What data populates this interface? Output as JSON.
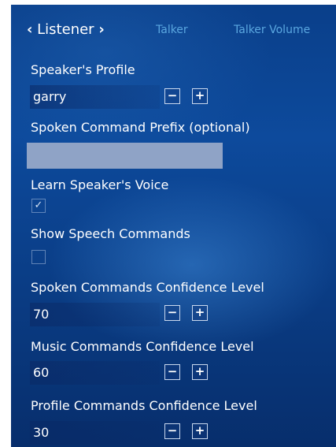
{
  "tabs": {
    "listener": "Listener",
    "talker": "Talker",
    "talker_volume": "Talker Volume"
  },
  "icons": {
    "prev": "chevron-left-icon",
    "next": "chevron-right-icon",
    "minus": "minus-icon",
    "plus": "plus-icon",
    "check": "checkmark-icon"
  },
  "settings": {
    "speakers_profile": {
      "label": "Speaker's Profile",
      "value": "garry"
    },
    "command_prefix": {
      "label": "Spoken Command Prefix (optional)",
      "value": ""
    },
    "learn_voice": {
      "label": "Learn Speaker's Voice",
      "checked": true
    },
    "show_commands": {
      "label": "Show Speech Commands",
      "checked": false
    },
    "spoken_confidence": {
      "label": "Spoken Commands Confidence Level",
      "value": "70"
    },
    "music_confidence": {
      "label": "Music Commands Confidence Level",
      "value": "60"
    },
    "profile_confidence": {
      "label": "Profile Commands Confidence Level",
      "value": "30"
    }
  },
  "buttons": {
    "minus": "−",
    "plus": "+"
  },
  "check_glyph": "✓",
  "colors": {
    "background": "#0d4a9c",
    "inactive_tab": "#5aa7e0",
    "text_field": "#8fa3c6"
  }
}
